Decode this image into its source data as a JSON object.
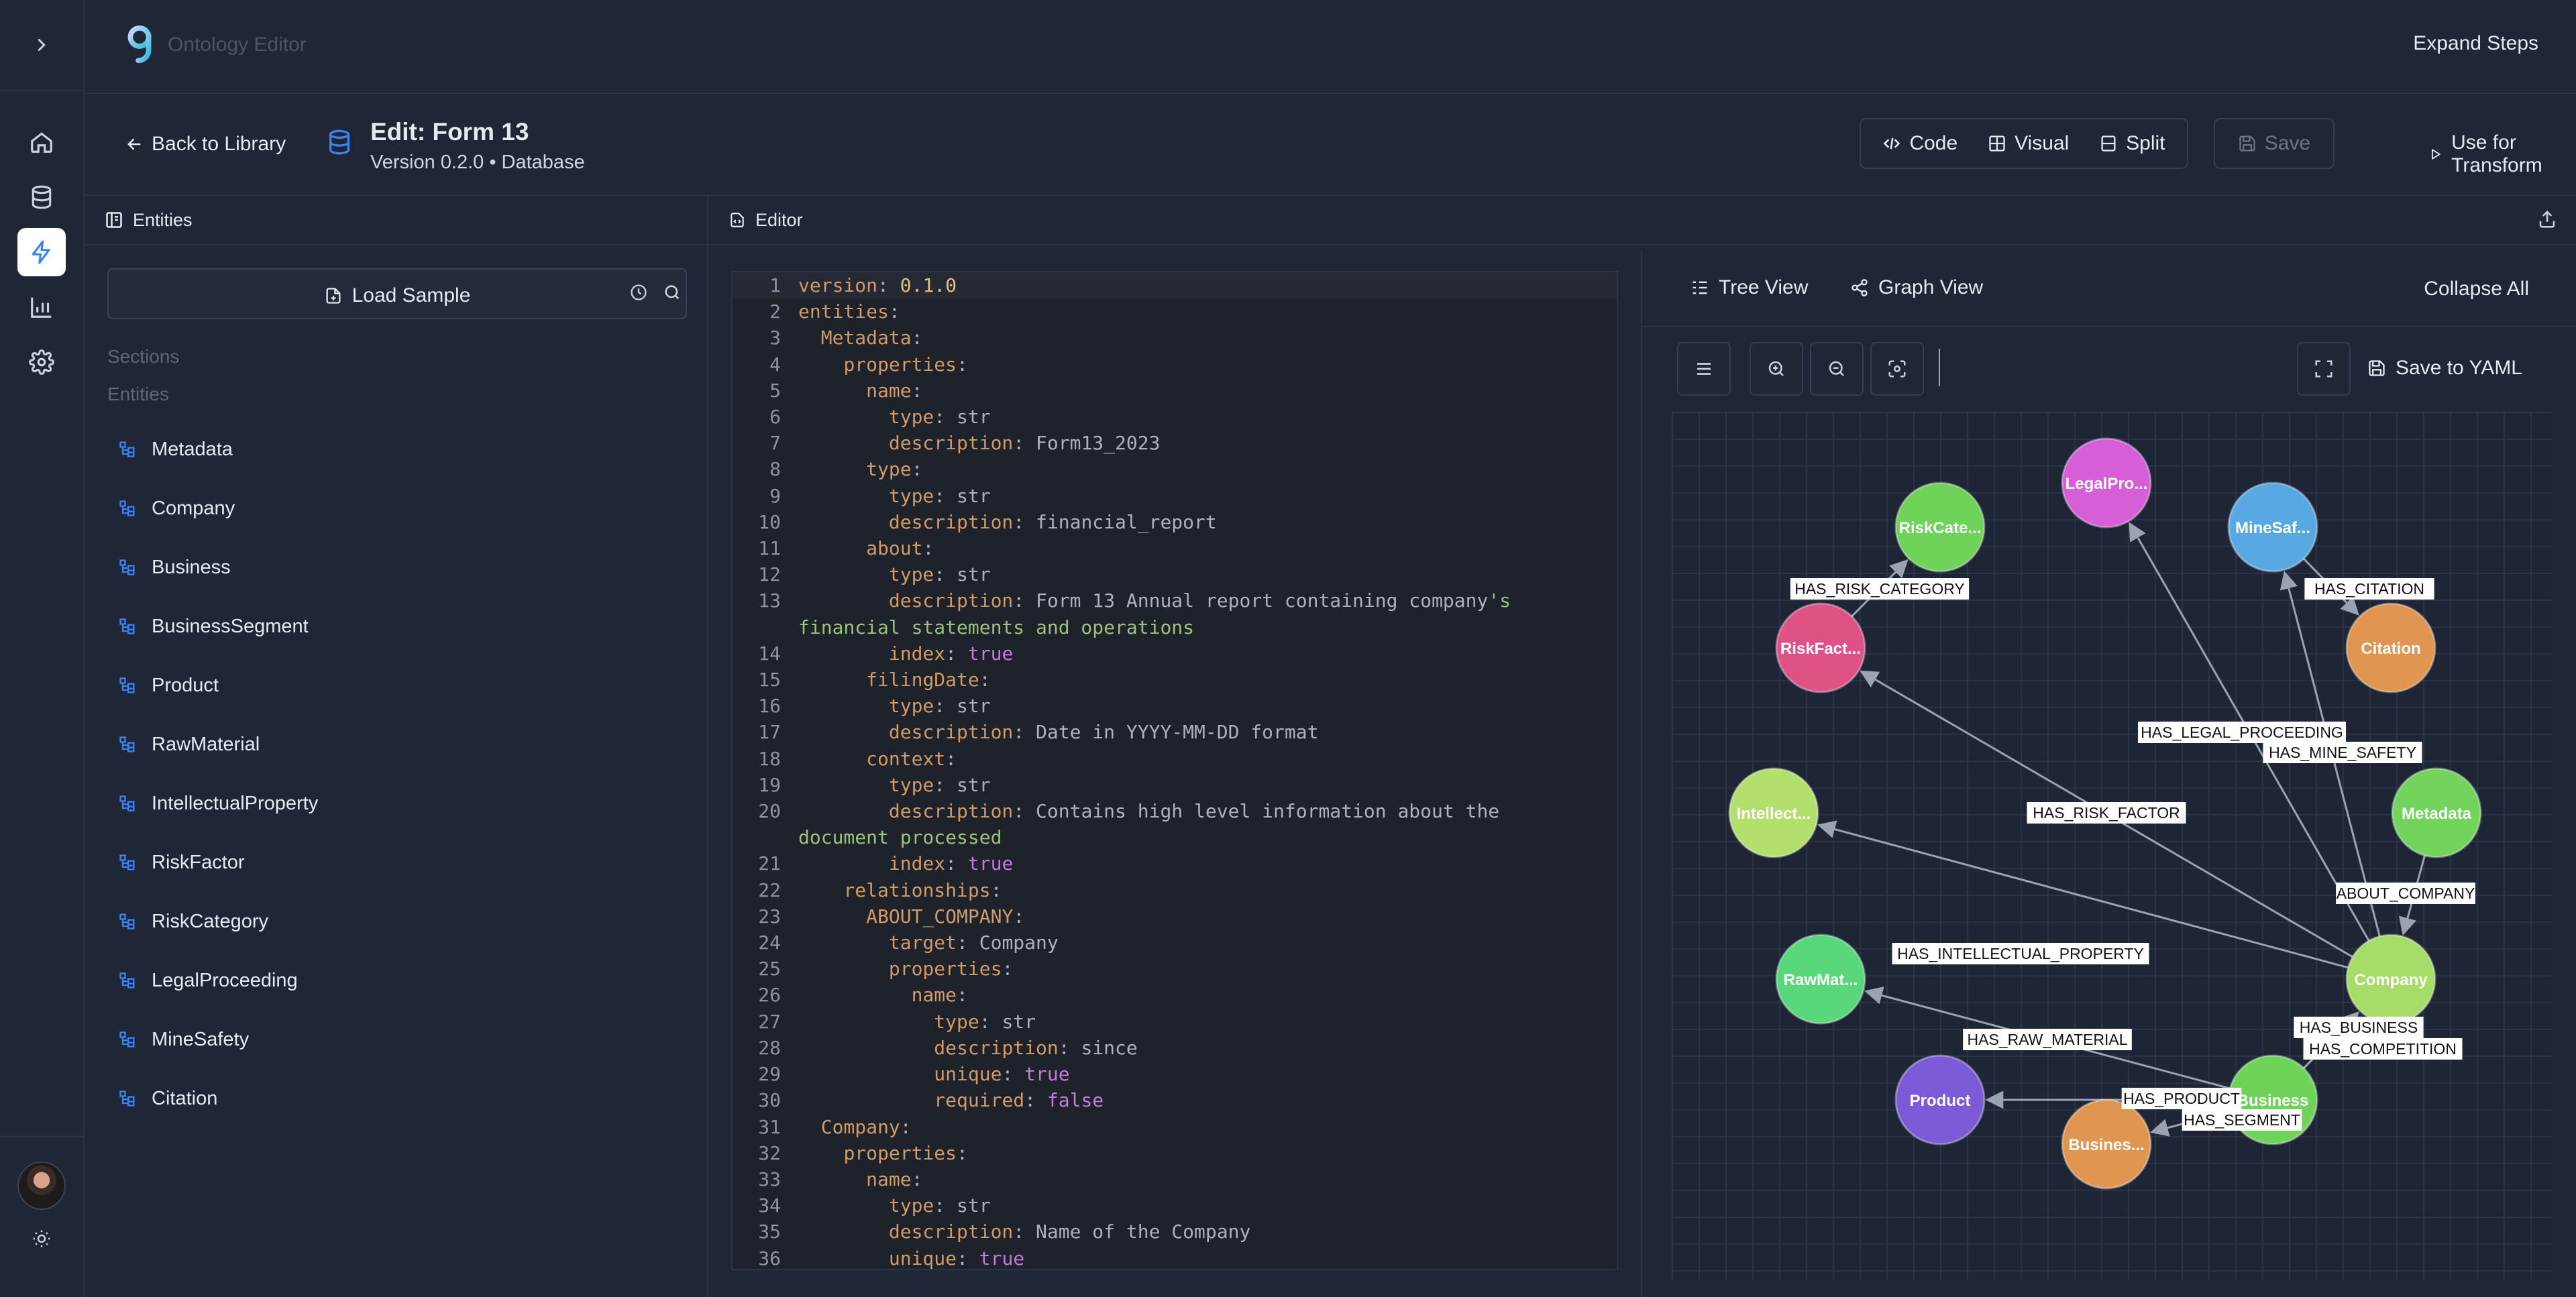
{
  "app": {
    "name": "Ontology Editor",
    "expand_steps": "Expand Steps"
  },
  "header": {
    "back": "Back to Library",
    "title": "Edit: Form 13",
    "subtitle": "Version 0.2.0 • Database",
    "modes": [
      "Code",
      "Visual",
      "Split"
    ],
    "save": "Save",
    "use_transform": "Use for Transform"
  },
  "entities_panel": {
    "title": "Entities",
    "load_sample": "Load Sample",
    "sections_label": "Sections",
    "entities_label": "Entities",
    "items": [
      "Metadata",
      "Company",
      "Business",
      "BusinessSegment",
      "Product",
      "RawMaterial",
      "IntellectualProperty",
      "RiskFactor",
      "RiskCategory",
      "LegalProceeding",
      "MineSafety",
      "Citation"
    ]
  },
  "editor": {
    "title": "Editor",
    "lines": [
      {
        "n": "1",
        "t": "version: 0.1.0"
      },
      {
        "n": "2",
        "t": "entities:"
      },
      {
        "n": "3",
        "t": "  Metadata:"
      },
      {
        "n": "4",
        "t": "    properties:"
      },
      {
        "n": "5",
        "t": "      name:"
      },
      {
        "n": "6",
        "t": "        type: str"
      },
      {
        "n": "7",
        "t": "        description: Form13_2023"
      },
      {
        "n": "8",
        "t": "      type:"
      },
      {
        "n": "9",
        "t": "        type: str"
      },
      {
        "n": "10",
        "t": "        description: financial_report"
      },
      {
        "n": "11",
        "t": "      about:"
      },
      {
        "n": "12",
        "t": "        type: str"
      },
      {
        "n": "13",
        "t": "        description: Form 13 Annual report containing company's"
      },
      {
        "n": "",
        "t": "financial statements and operations"
      },
      {
        "n": "14",
        "t": "        index: true"
      },
      {
        "n": "15",
        "t": "      filingDate:"
      },
      {
        "n": "16",
        "t": "        type: str"
      },
      {
        "n": "17",
        "t": "        description: Date in YYYY-MM-DD format"
      },
      {
        "n": "18",
        "t": "      context:"
      },
      {
        "n": "19",
        "t": "        type: str"
      },
      {
        "n": "20",
        "t": "        description: Contains high level information about the"
      },
      {
        "n": "",
        "t": "document processed"
      },
      {
        "n": "21",
        "t": "        index: true"
      },
      {
        "n": "22",
        "t": "    relationships:"
      },
      {
        "n": "23",
        "t": "      ABOUT_COMPANY:"
      },
      {
        "n": "24",
        "t": "        target: Company"
      },
      {
        "n": "25",
        "t": "        properties:"
      },
      {
        "n": "26",
        "t": "          name:"
      },
      {
        "n": "27",
        "t": "            type: str"
      },
      {
        "n": "28",
        "t": "            description: since"
      },
      {
        "n": "29",
        "t": "            unique: true"
      },
      {
        "n": "30",
        "t": "            required: false"
      },
      {
        "n": "31",
        "t": "  Company:"
      },
      {
        "n": "32",
        "t": "    properties:"
      },
      {
        "n": "33",
        "t": "      name:"
      },
      {
        "n": "34",
        "t": "        type: str"
      },
      {
        "n": "35",
        "t": "        description: Name of the Company"
      },
      {
        "n": "36",
        "t": "        unique: true"
      }
    ]
  },
  "graph": {
    "tabs": [
      "Tree View",
      "Graph View"
    ],
    "collapse_all": "Collapse All",
    "save_yaml": "Save to YAML",
    "nodes": [
      {
        "id": "riskcat",
        "label": "RiskCate...",
        "color": "#6fd35a"
      },
      {
        "id": "legal",
        "label": "LegalPro...",
        "color": "#d65fd8"
      },
      {
        "id": "mine",
        "label": "MineSaf...",
        "color": "#58a8e4"
      },
      {
        "id": "riskfact",
        "label": "RiskFact...",
        "color": "#de5285"
      },
      {
        "id": "citation",
        "label": "Citation",
        "color": "#e09550"
      },
      {
        "id": "intel",
        "label": "Intellect...",
        "color": "#b3e06c"
      },
      {
        "id": "meta",
        "label": "Metadata",
        "color": "#72d45c"
      },
      {
        "id": "company",
        "label": "Company",
        "color": "#a6dc68"
      },
      {
        "id": "rawmat",
        "label": "RawMat...",
        "color": "#58d87a"
      },
      {
        "id": "product",
        "label": "Product",
        "color": "#7b5bd8"
      },
      {
        "id": "business",
        "label": "Business",
        "color": "#6fd35a"
      },
      {
        "id": "busseg",
        "label": "Busines...",
        "color": "#e09550"
      }
    ],
    "edges": [
      {
        "from": "riskfact",
        "to": "riskcat",
        "label": "HAS_RISK_CATEGORY"
      },
      {
        "from": "mine",
        "to": "citation",
        "label": "HAS_CITATION"
      },
      {
        "from": "company",
        "to": "legal",
        "label": "HAS_LEGAL_PROCEEDING"
      },
      {
        "from": "company",
        "to": "mine",
        "label": "HAS_MINE_SAFETY"
      },
      {
        "from": "company",
        "to": "riskfact",
        "label": "HAS_RISK_FACTOR"
      },
      {
        "from": "meta",
        "to": "company",
        "label": "ABOUT_COMPANY"
      },
      {
        "from": "company",
        "to": "intel",
        "label": "HAS_INTELLECTUAL_PROPERTY"
      },
      {
        "from": "business",
        "to": "rawmat",
        "label": "HAS_RAW_MATERIAL"
      },
      {
        "from": "business",
        "to": "company",
        "label": "HAS_BUSINESS"
      },
      {
        "from": "business",
        "to": "company",
        "label": "HAS_COMPETITION"
      },
      {
        "from": "business",
        "to": "product",
        "label": "HAS_PRODUCT"
      },
      {
        "from": "business",
        "to": "busseg",
        "label": "HAS_SEGMENT"
      }
    ]
  }
}
